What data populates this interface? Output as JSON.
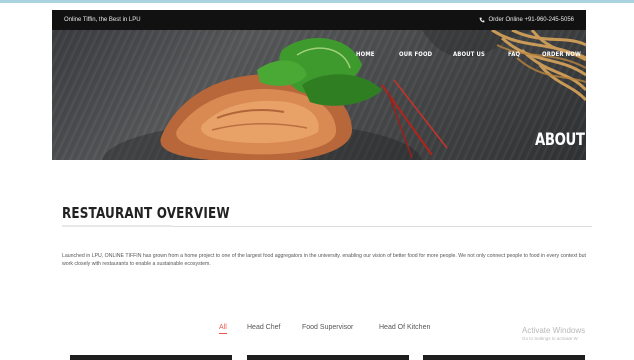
{
  "topbar": {
    "tagline": "Online Tiffin, the Best in LPU",
    "phone_label": "Order Online +91-960-245-5056",
    "phone_icon": "phone-icon"
  },
  "nav": {
    "items": [
      {
        "label": "HOME"
      },
      {
        "label": "OUR FOOD"
      },
      {
        "label": "ABOUT US"
      },
      {
        "label": "FAQ"
      },
      {
        "label": "ORDER NOW"
      }
    ]
  },
  "hero": {
    "title": "ABOUT US"
  },
  "overview": {
    "title": "RESTAURANT OVERVIEW",
    "text": "Launched in LPU, ONLINE TIFFIN has grown from a home project to one of the largest food aggregators in the university. enabling our vision of better food for more people. We not only connect people to food in every context but work closely with restaurants to enable a sustainable ecosystem."
  },
  "team_filters": {
    "items": [
      {
        "label": "All",
        "active": true
      },
      {
        "label": "Head Chef",
        "active": false
      },
      {
        "label": "Food Supervisor",
        "active": false
      },
      {
        "label": "Head Of Kitchen",
        "active": false
      }
    ]
  },
  "watermark": {
    "line1": "Activate Windows",
    "line2": "Go to Settings to activate W"
  },
  "colors": {
    "accent": "#e8584f",
    "topbar_bg": "#111111",
    "top_line": "#a9d3de"
  }
}
